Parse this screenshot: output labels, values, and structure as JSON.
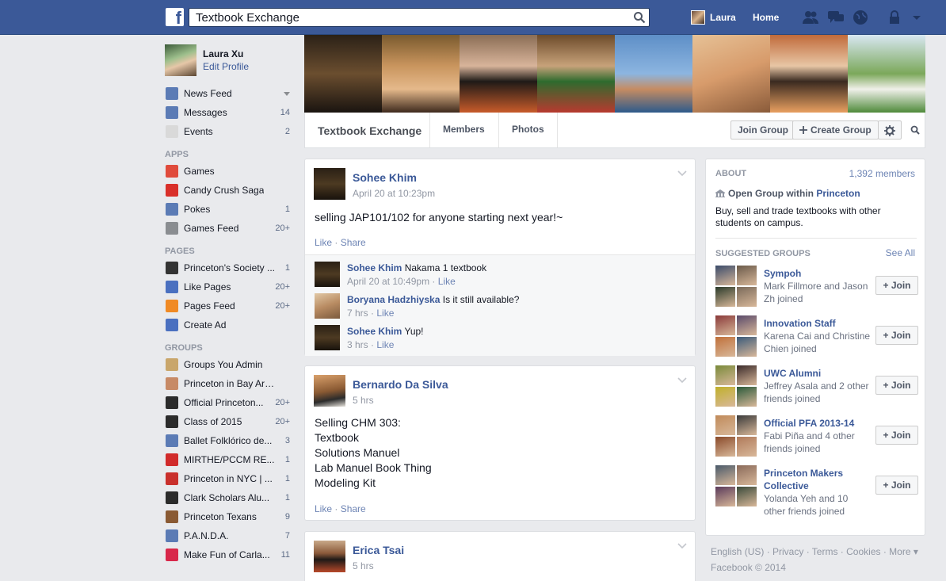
{
  "topbar": {
    "search_value": "Textbook Exchange",
    "user_name": "Laura",
    "home_label": "Home"
  },
  "leftnav": {
    "profile_name": "Laura Xu",
    "edit_profile": "Edit Profile",
    "main_items": [
      {
        "label": "News Feed",
        "count": "",
        "icon": "news-feed-icon"
      },
      {
        "label": "Messages",
        "count": "14",
        "icon": "messages-icon"
      },
      {
        "label": "Events",
        "count": "2",
        "icon": "events-icon"
      }
    ],
    "apps_header": "APPS",
    "apps": [
      {
        "label": "Games",
        "count": "",
        "icon": "games-icon"
      },
      {
        "label": "Candy Crush Saga",
        "count": "",
        "icon": "candy-crush-icon"
      },
      {
        "label": "Pokes",
        "count": "1",
        "icon": "pokes-icon"
      },
      {
        "label": "Games Feed",
        "count": "20+",
        "icon": "games-feed-icon"
      }
    ],
    "pages_header": "PAGES",
    "pages": [
      {
        "label": "Princeton's Society ...",
        "count": "1",
        "icon": "society-icon"
      },
      {
        "label": "Like Pages",
        "count": "20+",
        "icon": "like-icon"
      },
      {
        "label": "Pages Feed",
        "count": "20+",
        "icon": "pages-feed-icon"
      },
      {
        "label": "Create Ad",
        "count": "",
        "icon": "create-ad-icon"
      }
    ],
    "groups_header": "GROUPS",
    "groups": [
      {
        "label": "Groups You Admin",
        "count": "",
        "icon": "groups-admin-icon"
      },
      {
        "label": "Princeton in Bay Area...",
        "count": "",
        "icon": "group-hand-icon"
      },
      {
        "label": "Official Princeton...",
        "count": "20+",
        "icon": "grad-cap-icon"
      },
      {
        "label": "Class of 2015",
        "count": "20+",
        "icon": "grad-cap-icon"
      },
      {
        "label": "Ballet Folklórico de...",
        "count": "3",
        "icon": "group-people-icon"
      },
      {
        "label": "MIRTHE/PCCM RE...",
        "count": "1",
        "icon": "red-cup-icon"
      },
      {
        "label": "Princeton in NYC | ...",
        "count": "1",
        "icon": "apple-icon"
      },
      {
        "label": "Clark Scholars Alu...",
        "count": "1",
        "icon": "grad-cap-icon"
      },
      {
        "label": "Princeton Texans",
        "count": "9",
        "icon": "horse-icon"
      },
      {
        "label": "P.A.N.D.A.",
        "count": "7",
        "icon": "group-people-icon"
      },
      {
        "label": "Make Fun of Carla...",
        "count": "11",
        "icon": "heart-icon"
      }
    ]
  },
  "group": {
    "title": "Textbook Exchange",
    "tabs": [
      "Members",
      "Photos"
    ],
    "join_label": "Join Group",
    "create_label": "Create Group"
  },
  "posts": [
    {
      "author": "Sohee Khim",
      "time": "April 20 at 10:23pm",
      "text": "selling JAP101/102 for anyone starting next year!~",
      "like": "Like",
      "share": "Share",
      "comments": [
        {
          "name": "Sohee Khim",
          "text": "Nakama 1 textbook",
          "time": "April 20 at 10:49pm",
          "like": "Like"
        },
        {
          "name": "Boryana Hadzhiyska",
          "text": "Is it still available?",
          "time": "7 hrs",
          "like": "Like"
        },
        {
          "name": "Sohee Khim",
          "text": "Yup!",
          "time": "3 hrs",
          "like": "Like"
        }
      ]
    },
    {
      "author": "Bernardo Da Silva",
      "time": "5 hrs",
      "lines": [
        "Selling CHM 303:",
        "Textbook",
        "Solutions Manuel",
        "Lab Manuel Book Thing",
        "Modeling Kit"
      ],
      "like": "Like",
      "share": "Share"
    },
    {
      "author": "Erica Tsai",
      "time": "5 hrs"
    }
  ],
  "about": {
    "header": "ABOUT",
    "members": "1,392 members",
    "type_prefix": "Open Group within",
    "type_school": "Princeton",
    "description": "Buy, sell and trade textbooks with other students on campus.",
    "suggested_header": "SUGGESTED GROUPS",
    "see_all": "See All",
    "join_label": "+ Join",
    "suggested": [
      {
        "name": "Sympoh",
        "sub": "Mark Fillmore and Jason Zh joined"
      },
      {
        "name": "Innovation Staff",
        "sub": "Karena Cai and Christine Chien joined"
      },
      {
        "name": "UWC Alumni",
        "sub": "Jeffrey Asala and 2 other friends joined"
      },
      {
        "name": "Official PFA 2013-14",
        "sub": "Fabi Piña and 4 other friends joined"
      },
      {
        "name": "Princeton Makers Collective",
        "sub": "Yolanda Yeh and 10 other friends joined"
      }
    ]
  },
  "footer": {
    "links": "English (US) · Privacy · Terms · Cookies · More ▾",
    "copyright": "Facebook © 2014"
  }
}
